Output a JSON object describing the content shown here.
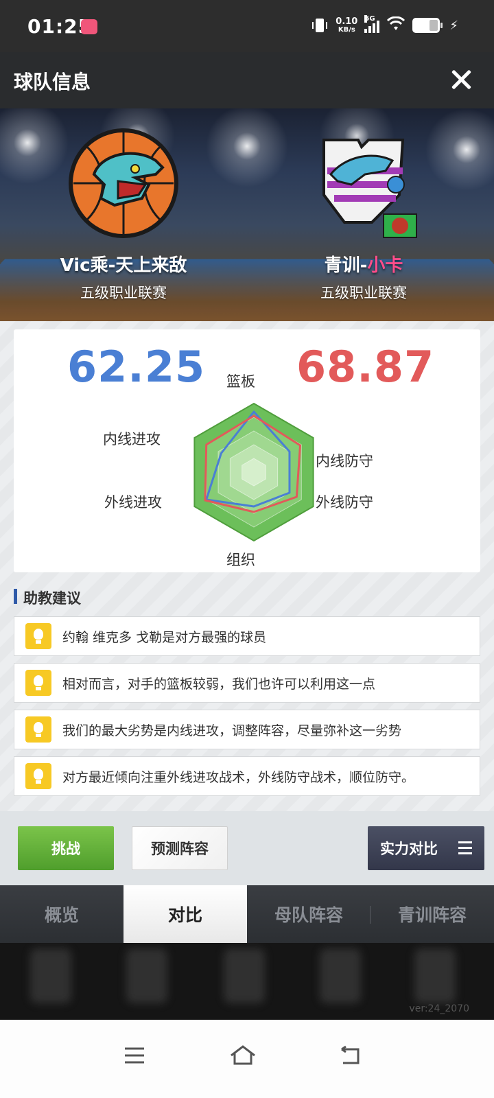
{
  "status_bar": {
    "time": "01:25",
    "net_speed_value": "0.10",
    "net_speed_unit": "KB/s",
    "network": "5G"
  },
  "header": {
    "title": "球队信息",
    "close_icon": "close-icon"
  },
  "banner": {
    "team_left": {
      "name": "Vic乘-天上来敌",
      "league": "五级职业联赛"
    },
    "team_right": {
      "name_prefix": "青训-",
      "name_highlight": "小卡",
      "league": "五级职业联赛"
    }
  },
  "comparison": {
    "score_left": "62.25",
    "score_right": "68.87",
    "axes": [
      "篮板",
      "内线防守",
      "外线防守",
      "组织",
      "外线进攻",
      "内线进攻"
    ],
    "colors": {
      "left": "#4a7fd4",
      "right": "#e25a5a",
      "radar_fill": "#5cb85c"
    }
  },
  "chart_data": {
    "type": "radar",
    "axes": [
      "篮板",
      "内线防守",
      "外线防守",
      "组织",
      "外线进攻",
      "内线进攻"
    ],
    "range": [
      0,
      1
    ],
    "series": [
      {
        "color": "#4a7fd4",
        "values": [
          0.88,
          0.6,
          0.6,
          0.5,
          0.8,
          0.55
        ]
      },
      {
        "color": "#e25a5a",
        "values": [
          0.82,
          0.78,
          0.72,
          0.58,
          0.82,
          0.8
        ]
      }
    ]
  },
  "advice": {
    "title": "助教建议",
    "items": [
      "约翰 维克多 戈勒是对方最强的球员",
      "相对而言，对手的篮板较弱，我们也许可以利用这一点",
      "我们的最大劣势是内线进攻，调整阵容，尽量弥补这一劣势",
      "对方最近倾向注重外线进攻战术，外线防守战术，顺位防守。"
    ]
  },
  "actions": {
    "challenge": "挑战",
    "predict": "预测阵容",
    "strength": "实力对比"
  },
  "tabs": [
    "概览",
    "对比",
    "母队阵容",
    "青训阵容"
  ],
  "active_tab": "对比",
  "footer": {
    "version": "ver:24_2070"
  }
}
